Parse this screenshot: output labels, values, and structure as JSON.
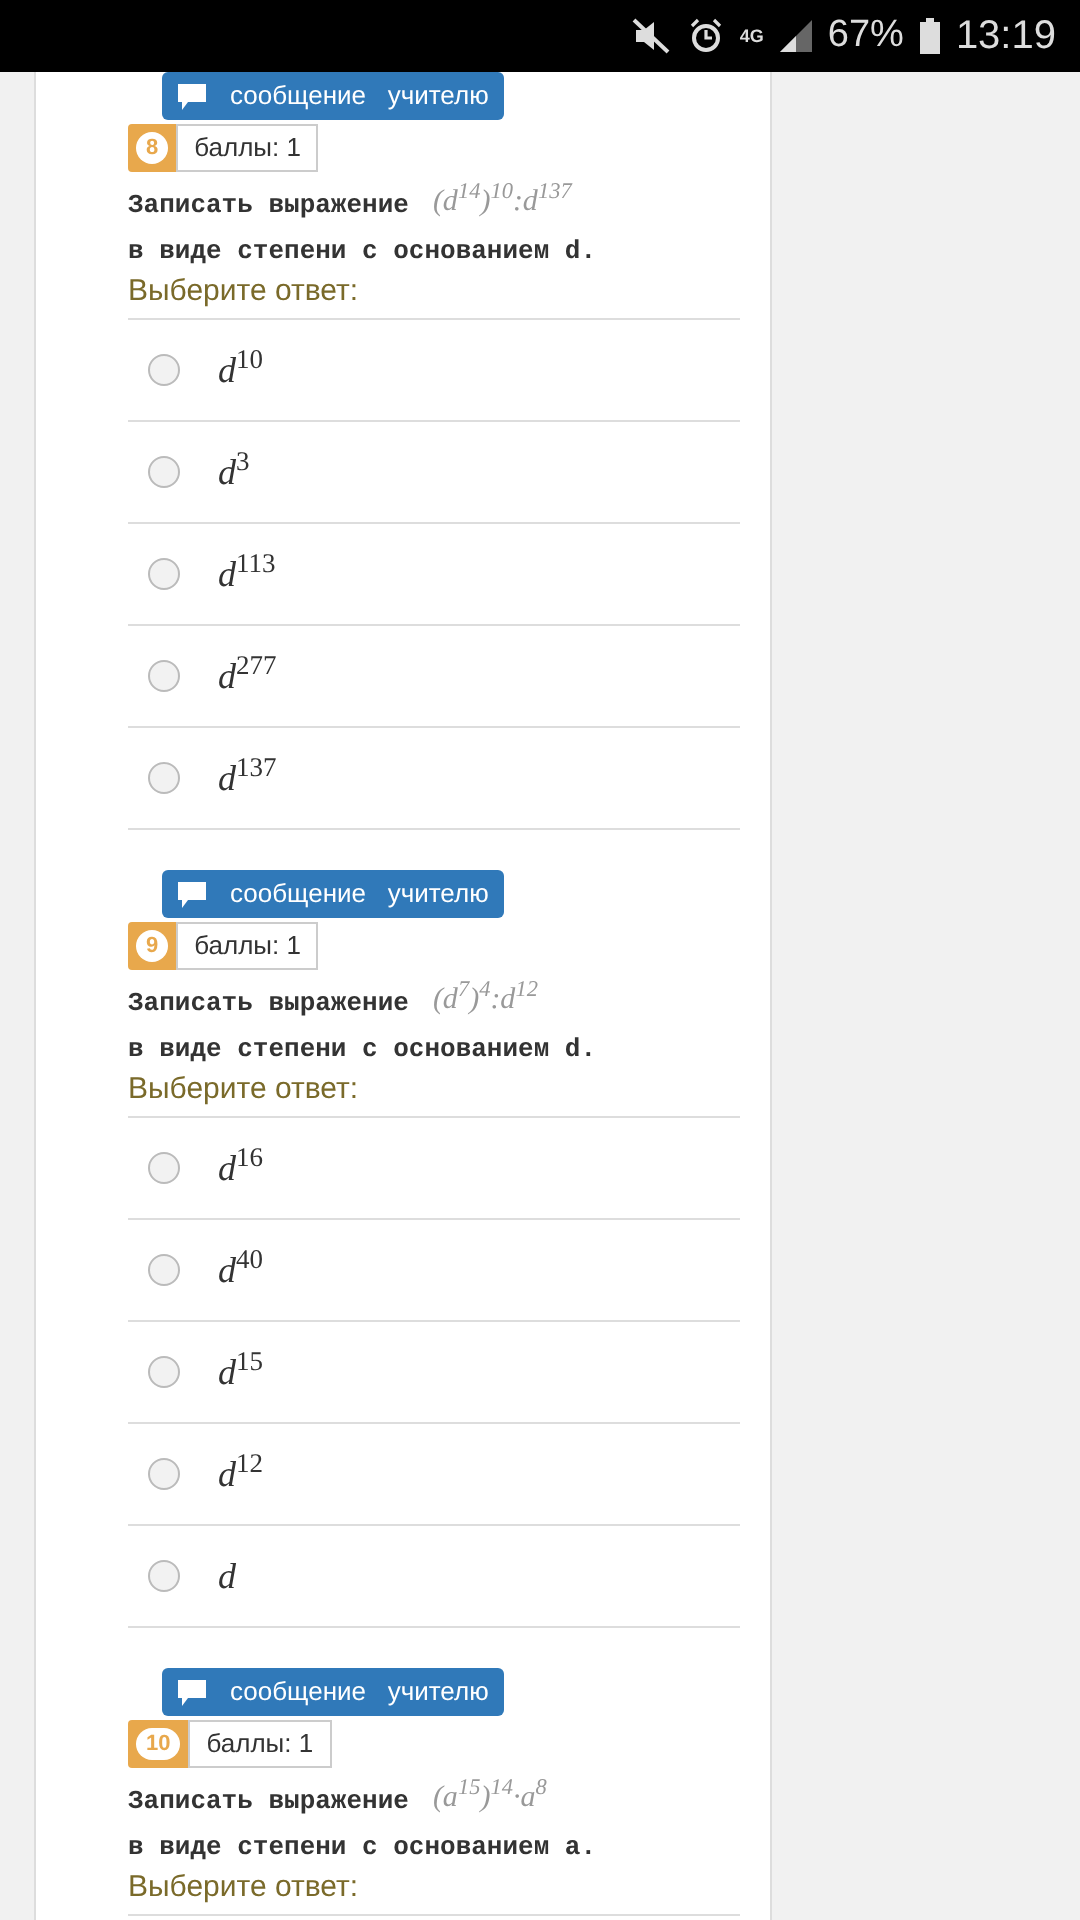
{
  "status_bar": {
    "network": "4G",
    "battery": "67%",
    "time": "13:19"
  },
  "questions": [
    {
      "message_button": "сообщение   учителю",
      "number": "8",
      "points": "баллы: 1",
      "line_1": "Записать выражение",
      "expression": "(d$^{14}$)$^{10}$:d$^{137}$",
      "line_2": "в виде степени с основанием d.",
      "prompt": "Выберите ответ:",
      "options": [
        {
          "label": "*d*$^{10}$",
          "selected": false
        },
        {
          "label": "*d*$^{3}$",
          "selected": false
        },
        {
          "label": "*d*$^{113}$",
          "selected": false
        },
        {
          "label": "*d*$^{277}$",
          "selected": false
        },
        {
          "label": "*d*$^{137}$",
          "selected": false
        }
      ]
    },
    {
      "message_button": "сообщение   учителю",
      "number": "9",
      "points": "баллы: 1",
      "line_1": "Записать выражение",
      "expression": "(d$^{7}$)$^{4}$:d$^{12}$",
      "line_2": "в виде степени с основанием d.",
      "prompt": "Выберите ответ:",
      "options": [
        {
          "label": "*d*$^{16}$",
          "selected": false
        },
        {
          "label": "*d*$^{40}$",
          "selected": false
        },
        {
          "label": "*d*$^{15}$",
          "selected": false
        },
        {
          "label": "*d*$^{12}$",
          "selected": false
        },
        {
          "label": "*d*",
          "selected": false
        }
      ]
    },
    {
      "message_button": "сообщение   учителю",
      "number": "10",
      "points": "баллы: 1",
      "line_1": "Записать выражение",
      "expression": "(a$^{15}$)$^{14}$·a$^{8}$",
      "line_2": "в виде степени с основанием a.",
      "prompt": "Выберите ответ:"
    }
  ]
}
